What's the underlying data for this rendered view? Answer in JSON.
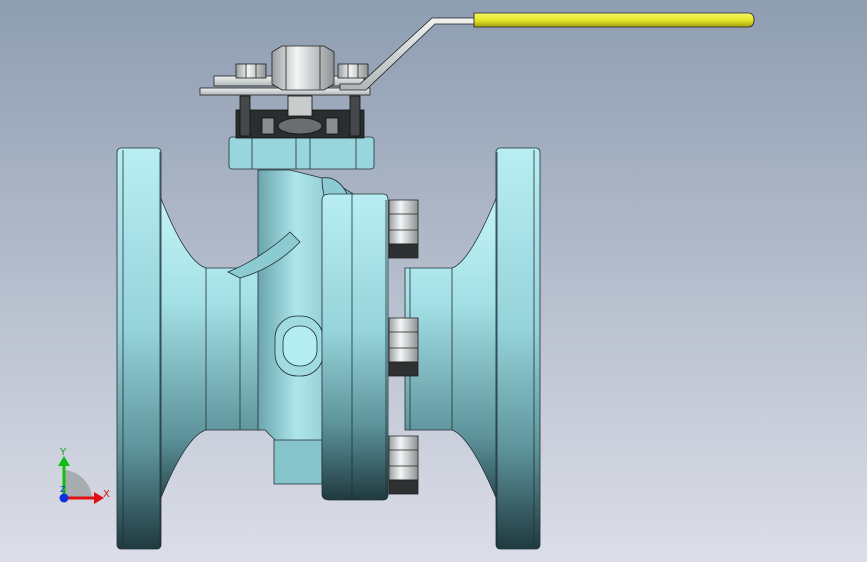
{
  "viewport": {
    "background_top": "#8e9db1",
    "background_bottom": "#dcdee8"
  },
  "model": {
    "body_color": "#a8dde4",
    "body_shadow": "#1f3a40",
    "bolt_color": "#e9ecec",
    "handle_grip_color": "#ecec2a",
    "stem_color": "#2b2e30"
  },
  "triad": {
    "x_label": "X",
    "y_label": "Y",
    "z_label": "Z",
    "x_color": "#e01010",
    "y_color": "#10c010",
    "z_color": "#1030e0"
  }
}
